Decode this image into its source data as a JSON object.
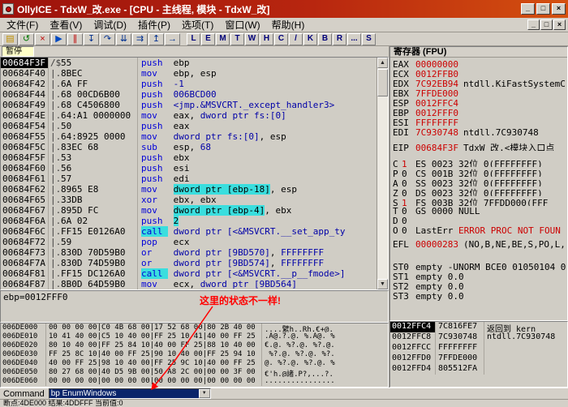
{
  "window": {
    "title": "OllyICE - TdxW_改.exe - [CPU -  主线程, 模块 - TdxW_改]",
    "title_buttons": [
      {
        "id": "minimize",
        "glyph": "_"
      },
      {
        "id": "maximize",
        "glyph": "□"
      },
      {
        "id": "close",
        "glyph": "×"
      }
    ],
    "mdi_buttons": [
      {
        "id": "mdi-minimize",
        "glyph": "_"
      },
      {
        "id": "mdi-restore",
        "glyph": "□"
      },
      {
        "id": "mdi-close",
        "glyph": "×"
      }
    ]
  },
  "state": {
    "label": "暂停"
  },
  "menu": {
    "items": [
      {
        "id": "file",
        "label": "文件(F)"
      },
      {
        "id": "view",
        "label": "查看(V)"
      },
      {
        "id": "debug",
        "label": "调试(D)"
      },
      {
        "id": "plugins",
        "label": "插件(P)"
      },
      {
        "id": "options",
        "label": "选项(T)"
      },
      {
        "id": "window",
        "label": "窗口(W)"
      },
      {
        "id": "help",
        "label": "帮助(H)"
      }
    ]
  },
  "toolbar": {
    "icons": [
      {
        "id": "open-file",
        "icon": "open-folder-icon",
        "glyph": "▤",
        "color": "#c09000"
      },
      {
        "id": "restart",
        "icon": "restart-icon",
        "glyph": "↺",
        "color": "#007800"
      },
      {
        "id": "close-program",
        "icon": "close-program-icon",
        "glyph": "×",
        "color": "#c00000"
      },
      {
        "id": "run",
        "icon": "run-icon",
        "glyph": "▶",
        "color": "#0048c0"
      },
      {
        "id": "pause",
        "icon": "pause-icon",
        "glyph": "∥",
        "color": "#c00000"
      },
      {
        "id": "step-into",
        "icon": "step-into-icon",
        "glyph": "↧",
        "color": "#003090"
      },
      {
        "id": "step-over",
        "icon": "step-over-icon",
        "glyph": "↷",
        "color": "#003090"
      },
      {
        "id": "animate-into",
        "icon": "animate-into-icon",
        "glyph": "⇊",
        "color": "#003090"
      },
      {
        "id": "animate-over",
        "icon": "animate-over-icon",
        "glyph": "⇉",
        "color": "#003090"
      },
      {
        "id": "execute-till-return",
        "icon": "till-return-icon",
        "glyph": "↥",
        "color": "#003090"
      },
      {
        "id": "go-to-address",
        "icon": "goto-icon",
        "glyph": "→",
        "color": "#003090"
      }
    ],
    "letters": [
      {
        "id": "log-window",
        "label": "L"
      },
      {
        "id": "executables-window",
        "label": "E"
      },
      {
        "id": "memory-window",
        "label": "M"
      },
      {
        "id": "threads-window",
        "label": "T"
      },
      {
        "id": "windows-window",
        "label": "W"
      },
      {
        "id": "handles-window",
        "label": "H"
      },
      {
        "id": "cpu-window",
        "label": "C"
      },
      {
        "id": "patches-window",
        "label": "/"
      },
      {
        "id": "call-stack-window",
        "label": "K"
      },
      {
        "id": "breakpoints-window",
        "label": "B"
      },
      {
        "id": "references-window",
        "label": "R"
      },
      {
        "id": "run-trace-window",
        "label": "..."
      },
      {
        "id": "source-window",
        "label": "S"
      }
    ]
  },
  "disasm": {
    "rows": [
      {
        "addr": "00684F3F",
        "sel": true,
        "prefix": "/$",
        "bytes": "55",
        "segs": [
          [
            "m",
            "push"
          ],
          [
            "o",
            " ebp"
          ]
        ]
      },
      {
        "addr": "00684F40",
        "prefix": "|.",
        "bytes": "8BEC",
        "segs": [
          [
            "m",
            "mov"
          ],
          [
            "o",
            " ebp, esp"
          ]
        ]
      },
      {
        "addr": "00684F42",
        "prefix": "|.",
        "bytes": "6A FF",
        "segs": [
          [
            "m",
            "push"
          ],
          [
            "o",
            " "
          ],
          [
            "b",
            "-1"
          ]
        ]
      },
      {
        "addr": "00684F44",
        "prefix": "|.",
        "bytes": "68 00CD6B00",
        "segs": [
          [
            "m",
            "push"
          ],
          [
            "o",
            " "
          ],
          [
            "b",
            "006BCD00"
          ]
        ]
      },
      {
        "addr": "00684F49",
        "prefix": "|.",
        "bytes": "68 C4506800",
        "segs": [
          [
            "m",
            "push"
          ],
          [
            "o",
            " "
          ],
          [
            "b",
            "<jmp.&MSVCRT._except_handler3>"
          ]
        ]
      },
      {
        "addr": "00684F4E",
        "prefix": "|.",
        "bytes": "64:A1 0000000",
        "segs": [
          [
            "m",
            "mov"
          ],
          [
            "o",
            " eax, "
          ],
          [
            "b",
            "dword ptr fs:[0]"
          ]
        ]
      },
      {
        "addr": "00684F54",
        "prefix": "|.",
        "bytes": "50",
        "segs": [
          [
            "m",
            "push"
          ],
          [
            "o",
            " eax"
          ]
        ]
      },
      {
        "addr": "00684F55",
        "prefix": "|.",
        "bytes": "64:8925 0000",
        "segs": [
          [
            "m",
            "mov"
          ],
          [
            "o",
            " "
          ],
          [
            "b",
            "dword ptr fs:[0]"
          ],
          [
            "o",
            ", esp"
          ]
        ]
      },
      {
        "addr": "00684F5C",
        "prefix": "|.",
        "bytes": "83EC 68",
        "segs": [
          [
            "m",
            "sub"
          ],
          [
            "o",
            " esp, "
          ],
          [
            "b",
            "68"
          ]
        ]
      },
      {
        "addr": "00684F5F",
        "prefix": "|.",
        "bytes": "53",
        "segs": [
          [
            "m",
            "push"
          ],
          [
            "o",
            " ebx"
          ]
        ]
      },
      {
        "addr": "00684F60",
        "prefix": "|.",
        "bytes": "56",
        "segs": [
          [
            "m",
            "push"
          ],
          [
            "o",
            " esi"
          ]
        ]
      },
      {
        "addr": "00684F61",
        "prefix": "|.",
        "bytes": "57",
        "segs": [
          [
            "m",
            "push"
          ],
          [
            "o",
            " edi"
          ]
        ]
      },
      {
        "addr": "00684F62",
        "prefix": "|.",
        "bytes": "8965 E8",
        "segs": [
          [
            "m",
            "mov"
          ],
          [
            "o",
            " "
          ],
          [
            "h",
            "dword ptr [ebp-18]"
          ],
          [
            "o",
            ", esp"
          ]
        ]
      },
      {
        "addr": "00684F65",
        "prefix": "|.",
        "bytes": "33DB",
        "segs": [
          [
            "m",
            "xor"
          ],
          [
            "o",
            " ebx, ebx"
          ]
        ]
      },
      {
        "addr": "00684F67",
        "prefix": "|.",
        "bytes": "895D FC",
        "segs": [
          [
            "m",
            "mov"
          ],
          [
            "o",
            " "
          ],
          [
            "h",
            "dword ptr [ebp-4]"
          ],
          [
            "o",
            ", ebx"
          ]
        ]
      },
      {
        "addr": "00684F6A",
        "prefix": "|.",
        "bytes": "6A 02",
        "segs": [
          [
            "m",
            "push"
          ],
          [
            "o",
            " "
          ],
          [
            "h",
            "2"
          ]
        ]
      },
      {
        "addr": "00684F6C",
        "prefix": "|.",
        "bytes": "FF15 E0126A0",
        "segs": [
          [
            "mh",
            "call"
          ],
          [
            "o",
            " "
          ],
          [
            "b",
            "dword ptr [<&MSVCRT.__set_app_ty"
          ]
        ]
      },
      {
        "addr": "00684F72",
        "prefix": "|.",
        "bytes": "59",
        "segs": [
          [
            "m",
            "pop"
          ],
          [
            "o",
            " ecx"
          ]
        ]
      },
      {
        "addr": "00684F73",
        "prefix": "|.",
        "bytes": "830D 70D59B0",
        "segs": [
          [
            "m",
            "or"
          ],
          [
            "o",
            " "
          ],
          [
            "b",
            "dword ptr [9BD570]"
          ],
          [
            "o",
            ", "
          ],
          [
            "b",
            "FFFFFFFF"
          ]
        ]
      },
      {
        "addr": "00684F7A",
        "prefix": "|.",
        "bytes": "830D 74D59B0",
        "segs": [
          [
            "m",
            "or"
          ],
          [
            "o",
            " "
          ],
          [
            "b",
            "dword ptr [9BD574]"
          ],
          [
            "o",
            ", "
          ],
          [
            "b",
            "FFFFFFFF"
          ]
        ]
      },
      {
        "addr": "00684F81",
        "prefix": "|.",
        "bytes": "FF15 DC126A0",
        "segs": [
          [
            "mh",
            "call"
          ],
          [
            "o",
            " "
          ],
          [
            "b",
            "dword ptr [<&MSVCRT.__p__fmode>]"
          ]
        ]
      },
      {
        "addr": "00684F87",
        "prefix": "|.",
        "bytes": "8B0D 64D59B0",
        "segs": [
          [
            "m",
            "mov"
          ],
          [
            "o",
            " ecx, "
          ],
          [
            "b",
            "dword ptr [9BD564]"
          ]
        ]
      }
    ]
  },
  "info_pane": {
    "text": "ebp=0012FFF0"
  },
  "annotation": {
    "text": "这里的状态不一样!",
    "color": "#FF0000"
  },
  "registers": {
    "header": "寄存器 (FPU)",
    "regs": [
      {
        "name": "EAX",
        "value": "00000000"
      },
      {
        "name": "ECX",
        "value": "0012FFB0"
      },
      {
        "name": "EDX",
        "value": "7C92EB94",
        "comment": "ntdll.KiFastSystemC"
      },
      {
        "name": "EBX",
        "value": "7FFDE000"
      },
      {
        "name": "ESP",
        "value": "0012FFC4"
      },
      {
        "name": "EBP",
        "value": "0012FFF0"
      },
      {
        "name": "ESI",
        "value": "FFFFFFFF"
      },
      {
        "name": "EDI",
        "value": "7C930748",
        "comment": "ntdll.7C930748"
      },
      {
        "name": "EIP",
        "value": "00684F3F",
        "comment": "TdxW_改.<模块入口点",
        "gap": true
      }
    ],
    "flags": [
      {
        "f": "C",
        "v": "1",
        "seg": "ES 0023 32位 0(FFFFFFFF)"
      },
      {
        "f": "P",
        "v": "0",
        "seg": "CS 001B 32位 0(FFFFFFFF)"
      },
      {
        "f": "A",
        "v": "0",
        "seg": "SS 0023 32位 0(FFFFFFFF)"
      },
      {
        "f": "Z",
        "v": "0",
        "seg": "DS 0023 32位 0(FFFFFFFF)"
      },
      {
        "f": "S",
        "v": "1",
        "seg": "FS 003B 32位 7FFDD000(FFF"
      },
      {
        "f": "T",
        "v": "0",
        "seg": "GS 0000 NULL"
      },
      {
        "f": "D",
        "v": "0",
        "seg": ""
      },
      {
        "f": "O",
        "v": "0",
        "seg": "LastErr ",
        "err": "ERROR_PROC_NOT_FOUN"
      }
    ],
    "efl": {
      "label": "EFL",
      "value": "00000283",
      "suffix": "(NO,B,NE,BE,S,PO,L,"
    },
    "fpu": [
      {
        "name": "ST0",
        "value": "empty -UNORM BCE0 01050104 0"
      },
      {
        "name": "ST1",
        "value": "empty 0.0"
      },
      {
        "name": "ST2",
        "value": "empty 0.0"
      },
      {
        "name": "ST3",
        "value": "empty 0.0"
      }
    ]
  },
  "dump": {
    "rows": [
      {
        "addr": "006DE000",
        "hex": "00 00 00 00|C0 4B 68 00|17 52 68 00|80 2B 40 00",
        "ascii": "....繴h..Rh.€+@."
      },
      {
        "addr": "006DE010",
        "hex": "10 41 40 00|C5 10 40 00|FF 25 10 41|40 00 FF 25",
        "ascii": ".A@.?.@. %.A@. %"
      },
      {
        "addr": "006DE020",
        "hex": "80 10 40 00|FF 25 84 10|40 00 FF 25|88 10 40 00",
        "ascii": "€.@. %?.@. %?.@."
      },
      {
        "addr": "006DE030",
        "hex": "FF 25 8C 10|40 00 FF 25|90 10 40 00|FF 25 94 10",
        "asc": "",
        "ascii": " %?.@. %?.@. %?."
      },
      {
        "addr": "006DE040",
        "hex": "40 00 FF 25|98 10 40 00|FF 25 9C 10|40 00 FF 25",
        "ascii": "@. %?.@. %?.@. %"
      },
      {
        "addr": "006DE050",
        "hex": "80 27 68 00|40 D5 9B 00|50 A8 2C 00|00 00 3F 00",
        "ascii": "€'h.@諸.P?,...?."
      },
      {
        "addr": "006DE060",
        "hex": "00 00 00 00|00 00 00 00|00 00 00 00|00 00 00 00",
        "ascii": "................"
      }
    ]
  },
  "stack": {
    "rows": [
      {
        "addr": "0012FFC4",
        "sel": true,
        "value": "7C816FE7",
        "comment": "返回到 kern"
      },
      {
        "addr": "0012FFC8",
        "value": "7C930748",
        "comment": "ntdll.7C930748"
      },
      {
        "addr": "0012FFCC",
        "value": "FFFFFFFF",
        "comment": ""
      },
      {
        "addr": "0012FFD0",
        "value": "7FFDE000",
        "comment": ""
      },
      {
        "addr": "0012FFD4",
        "value": "805512FA",
        "comment": ""
      }
    ]
  },
  "command_bar": {
    "label": "Command",
    "value": "bp EnumWindows"
  },
  "status_bar": {
    "text": "断点:4DE000  结果:4DDFFF  当前值:0"
  },
  "colors": {
    "titlebar_red": "#9C120C",
    "changed_value_red": "#CC0000",
    "mnemonic_blue": "#0000D8",
    "operand_highlight_cyan": "#3ADEDE",
    "annotation_red": "#FF0000"
  }
}
